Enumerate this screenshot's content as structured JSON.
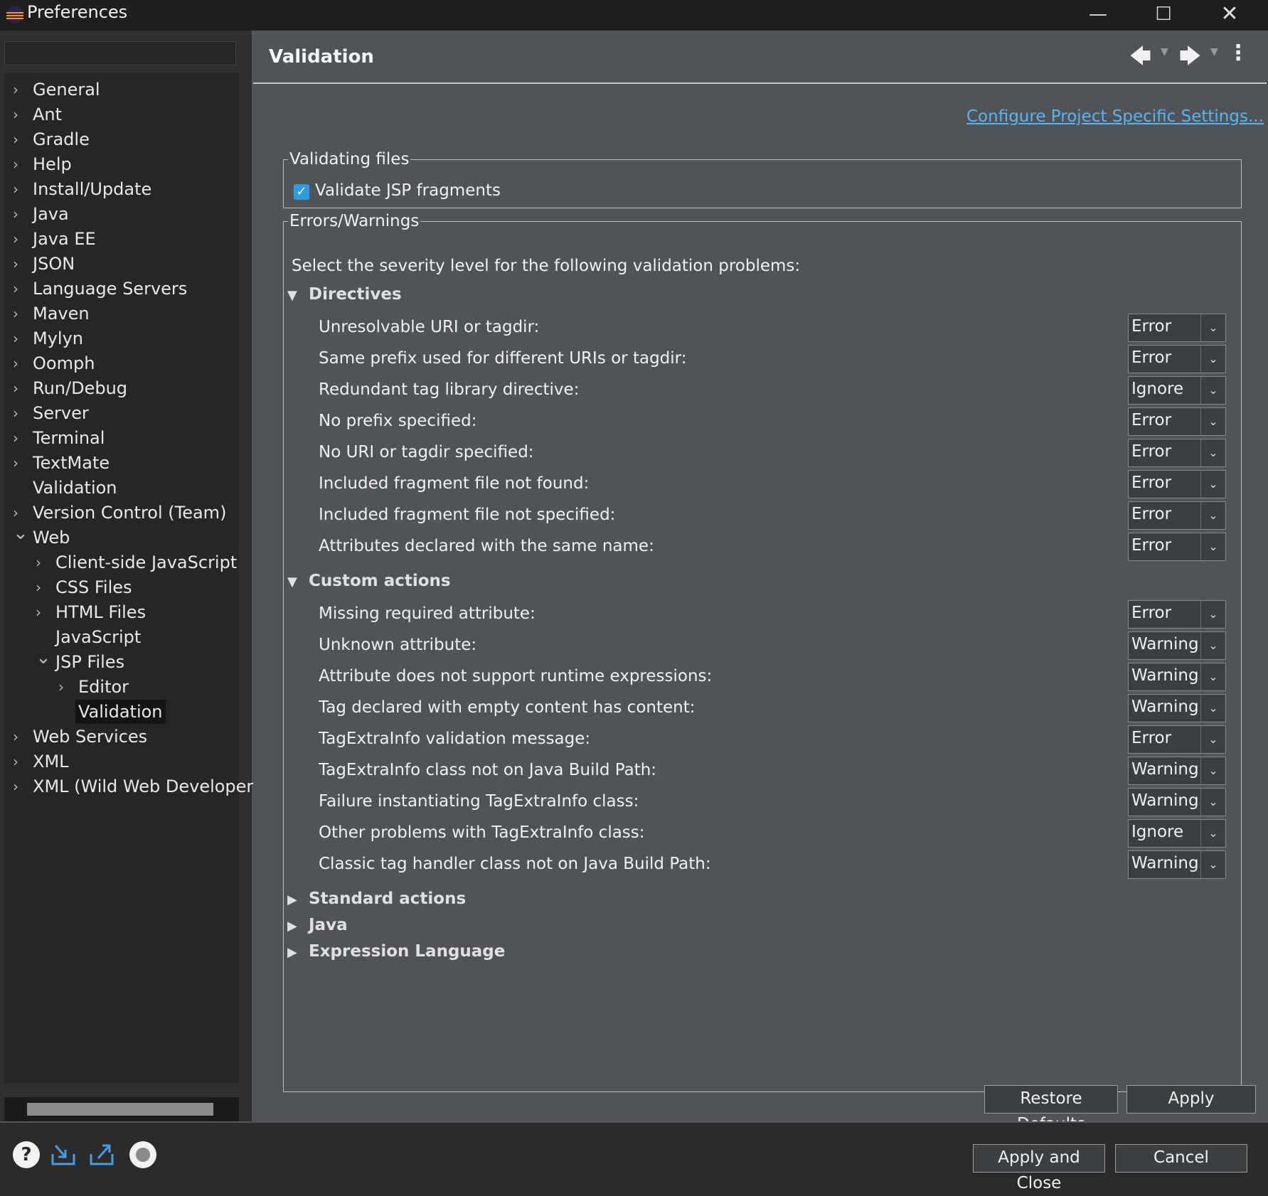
{
  "window": {
    "title": "Preferences"
  },
  "tree": {
    "filter_value": "",
    "items": [
      {
        "label": "General",
        "depth": 0,
        "expander": "collapsed"
      },
      {
        "label": "Ant",
        "depth": 0,
        "expander": "collapsed"
      },
      {
        "label": "Gradle",
        "depth": 0,
        "expander": "collapsed"
      },
      {
        "label": "Help",
        "depth": 0,
        "expander": "collapsed"
      },
      {
        "label": "Install/Update",
        "depth": 0,
        "expander": "collapsed"
      },
      {
        "label": "Java",
        "depth": 0,
        "expander": "collapsed"
      },
      {
        "label": "Java EE",
        "depth": 0,
        "expander": "collapsed"
      },
      {
        "label": "JSON",
        "depth": 0,
        "expander": "collapsed"
      },
      {
        "label": "Language Servers",
        "depth": 0,
        "expander": "collapsed"
      },
      {
        "label": "Maven",
        "depth": 0,
        "expander": "collapsed"
      },
      {
        "label": "Mylyn",
        "depth": 0,
        "expander": "collapsed"
      },
      {
        "label": "Oomph",
        "depth": 0,
        "expander": "collapsed"
      },
      {
        "label": "Run/Debug",
        "depth": 0,
        "expander": "collapsed"
      },
      {
        "label": "Server",
        "depth": 0,
        "expander": "collapsed"
      },
      {
        "label": "Terminal",
        "depth": 0,
        "expander": "collapsed"
      },
      {
        "label": "TextMate",
        "depth": 0,
        "expander": "collapsed"
      },
      {
        "label": "Validation",
        "depth": 0,
        "expander": "none"
      },
      {
        "label": "Version Control (Team)",
        "depth": 0,
        "expander": "collapsed"
      },
      {
        "label": "Web",
        "depth": 0,
        "expander": "expanded"
      },
      {
        "label": "Client-side JavaScript",
        "depth": 1,
        "expander": "collapsed"
      },
      {
        "label": "CSS Files",
        "depth": 1,
        "expander": "collapsed"
      },
      {
        "label": "HTML Files",
        "depth": 1,
        "expander": "collapsed"
      },
      {
        "label": "JavaScript",
        "depth": 1,
        "expander": "none"
      },
      {
        "label": "JSP Files",
        "depth": 1,
        "expander": "expanded"
      },
      {
        "label": "Editor",
        "depth": 2,
        "expander": "collapsed"
      },
      {
        "label": "Validation",
        "depth": 2,
        "expander": "none",
        "selected": true
      },
      {
        "label": "Web Services",
        "depth": 0,
        "expander": "collapsed"
      },
      {
        "label": "XML",
        "depth": 0,
        "expander": "collapsed"
      },
      {
        "label": "XML (Wild Web Developer)",
        "depth": 0,
        "expander": "collapsed"
      }
    ]
  },
  "page": {
    "title": "Validation",
    "config_link": "Configure Project Specific Settings...",
    "validating_files": {
      "legend": "Validating files",
      "validate_jsp_fragments": {
        "label": "Validate JSP fragments",
        "checked": true
      }
    },
    "errors_warnings": {
      "legend": "Errors/Warnings",
      "intro": "Select the severity level for the following validation problems:",
      "sections": [
        {
          "title": "Directives",
          "expanded": true,
          "items": [
            {
              "label": "Unresolvable URI or tagdir:",
              "value": "Error"
            },
            {
              "label": "Same prefix used for different URIs or tagdir:",
              "value": "Error"
            },
            {
              "label": "Redundant tag library directive:",
              "value": "Ignore"
            },
            {
              "label": "No prefix specified:",
              "value": "Error"
            },
            {
              "label": "No URI or tagdir specified:",
              "value": "Error"
            },
            {
              "label": "Included fragment file not found:",
              "value": "Error"
            },
            {
              "label": "Included fragment file not specified:",
              "value": "Error"
            },
            {
              "label": "Attributes declared with the same name:",
              "value": "Error"
            }
          ]
        },
        {
          "title": "Custom actions",
          "expanded": true,
          "items": [
            {
              "label": "Missing required attribute:",
              "value": "Error"
            },
            {
              "label": "Unknown attribute:",
              "value": "Warning"
            },
            {
              "label": "Attribute does not support runtime expressions:",
              "value": "Warning"
            },
            {
              "label": "Tag declared with empty content has content:",
              "value": "Warning"
            },
            {
              "label": "TagExtraInfo validation message:",
              "value": "Error"
            },
            {
              "label": "TagExtraInfo class not on Java Build Path:",
              "value": "Warning"
            },
            {
              "label": "Failure instantiating TagExtraInfo class:",
              "value": "Warning"
            },
            {
              "label": "Other problems with TagExtraInfo class:",
              "value": "Ignore"
            },
            {
              "label": "Classic tag handler class not on Java Build Path:",
              "value": "Warning"
            }
          ]
        },
        {
          "title": "Standard actions",
          "expanded": false,
          "items": []
        },
        {
          "title": "Java",
          "expanded": false,
          "items": []
        },
        {
          "title": "Expression Language",
          "expanded": false,
          "items": []
        }
      ]
    },
    "restore_defaults_label": "Restore Defaults",
    "apply_label": "Apply"
  },
  "footer": {
    "apply_close_label": "Apply and Close",
    "cancel_label": "Cancel"
  },
  "icons": {
    "back": "arrow-left-icon",
    "forward": "arrow-right-icon",
    "menu": "kebab-menu-icon",
    "help": "help-icon",
    "import": "import-icon",
    "export": "export-icon",
    "record": "record-icon"
  },
  "colors": {
    "accent": "#2f9be0",
    "link": "#5ab4f0",
    "panel": "#505458",
    "tree_bg": "#262626"
  }
}
